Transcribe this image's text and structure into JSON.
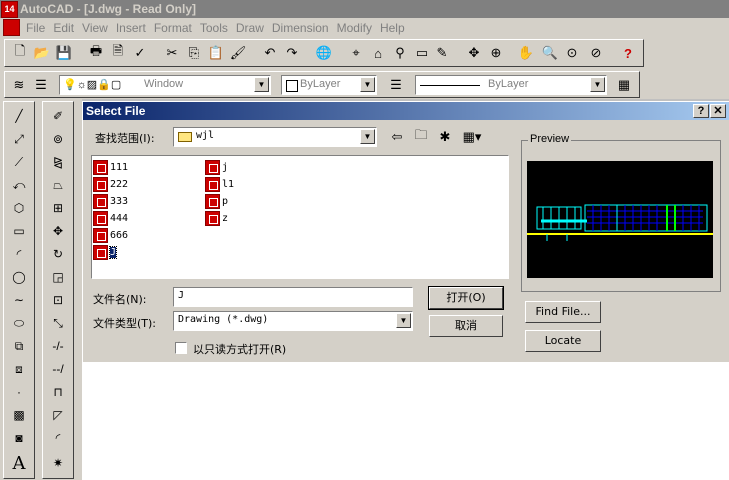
{
  "app": {
    "title": "AutoCAD - [J.dwg - Read Only]",
    "icon_text": "14"
  },
  "menu": [
    "File",
    "Edit",
    "View",
    "Insert",
    "Format",
    "Tools",
    "Draw",
    "Dimension",
    "Modify",
    "Help"
  ],
  "layer_toolbar": {
    "layer_value": "Window",
    "color_value": "ByLayer",
    "linetype_value": "ByLayer"
  },
  "dialog": {
    "title": "Select File",
    "look_in_label": "查找范围(I):",
    "look_in_value": "wjl",
    "files": [
      {
        "name": "111"
      },
      {
        "name": "222"
      },
      {
        "name": "333"
      },
      {
        "name": "444"
      },
      {
        "name": "666"
      },
      {
        "name": "J"
      },
      {
        "name": "j"
      },
      {
        "name": "l1"
      },
      {
        "name": "p"
      },
      {
        "name": "z"
      }
    ],
    "filename_label": "文件名(N):",
    "filename_value": "J",
    "filetype_label": "文件类型(T):",
    "filetype_value": "Drawing (*.dwg)",
    "open_button": "打开(O)",
    "cancel_button": "取消",
    "readonly_label": "以只读方式打开(R)",
    "readonly_checked": false,
    "preview_label": "Preview",
    "find_file_button": "Find File...",
    "locate_button": "Locate"
  },
  "colors": {
    "title_inactive": "#808080",
    "dialog_title_start": "#0a246a",
    "dialog_title_end": "#a6caf0",
    "face": "#d4d0c8",
    "preview_bg": "#000000",
    "preview_cyan": "#00ffff",
    "preview_blue": "#0000ff",
    "preview_yellow": "#ffff00",
    "preview_green": "#00ff00",
    "file_icon_red": "#cc0000"
  }
}
